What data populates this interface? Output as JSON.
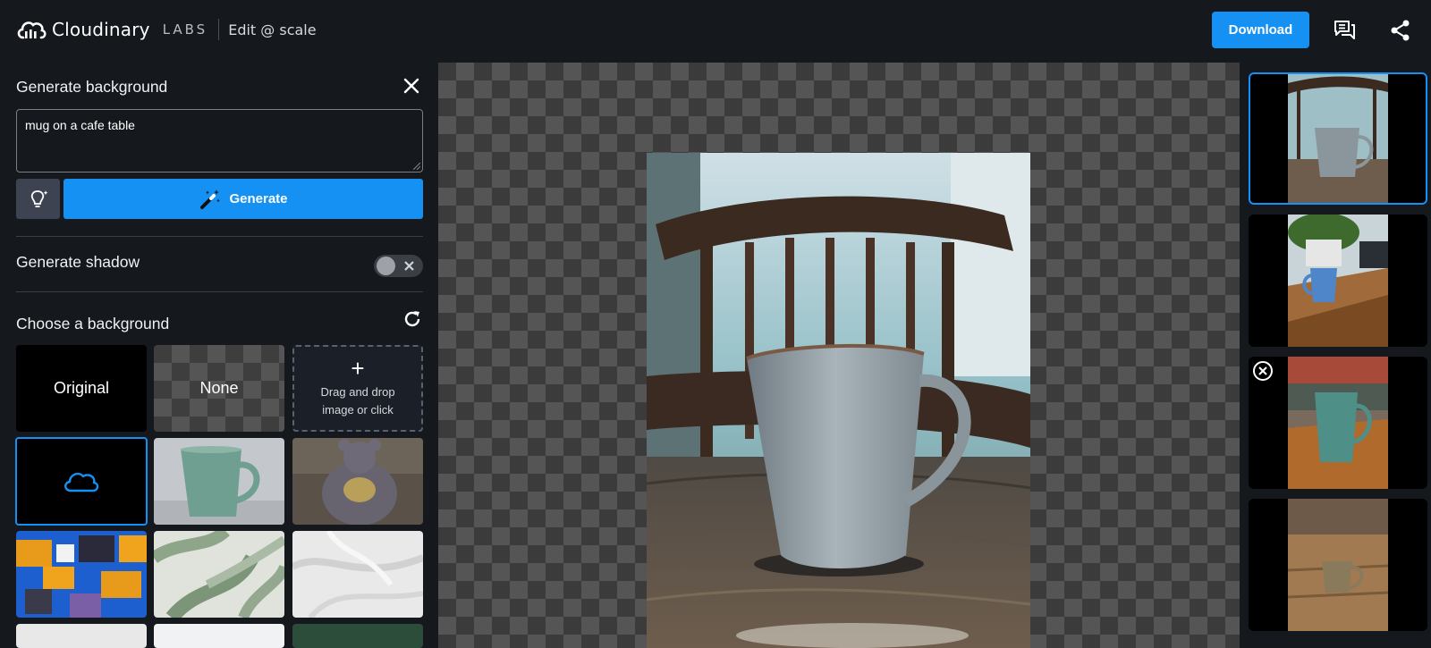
{
  "header": {
    "brand": "Cloudinary",
    "labs": "LABS",
    "subtitle": "Edit @ scale",
    "download_label": "Download"
  },
  "generate_background": {
    "title": "Generate background",
    "prompt_value": "mug on a cafe table",
    "generate_label": "Generate"
  },
  "generate_shadow": {
    "label": "Generate shadow",
    "enabled": false
  },
  "choose_background": {
    "title": "Choose a background",
    "tiles": {
      "original": "Original",
      "none": "None",
      "upload_plus": "+",
      "upload_text_1": "Drag and drop",
      "upload_text_2": "image or click"
    }
  },
  "colors": {
    "accent": "#1591f4",
    "background": "#15181d"
  },
  "icons": [
    "cloud-logo-icon",
    "chat-icon",
    "share-icon",
    "close-icon",
    "lightbulb-icon",
    "magic-wand-icon",
    "refresh-icon",
    "cloud-icon",
    "remove-icon"
  ]
}
